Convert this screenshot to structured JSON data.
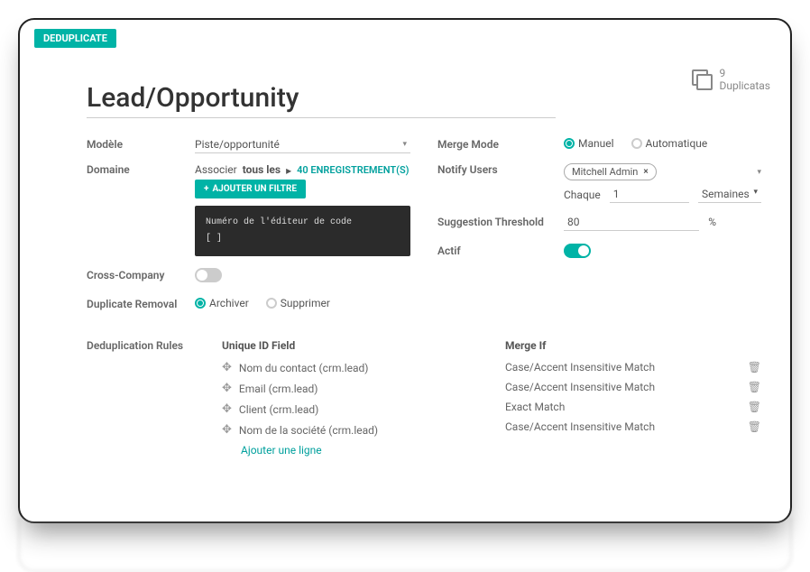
{
  "tag": "DEDUPLICATE",
  "duplicates": {
    "count": "9",
    "label": "Duplicatas"
  },
  "title": "Lead/Opportunity",
  "labels": {
    "model": "Modèle",
    "domain": "Domaine",
    "cross_company": "Cross-Company",
    "duplicate_removal": "Duplicate Removal",
    "merge_mode": "Merge Mode",
    "notify_users": "Notify Users",
    "suggestion_threshold": "Suggestion Threshold",
    "actif": "Actif",
    "dedup_rules": "Deduplication Rules",
    "unique_id": "Unique ID Field",
    "merge_if": "Merge If",
    "each": "Chaque"
  },
  "model": "Piste/opportunité",
  "domain": {
    "prefix": "Associer",
    "bold": "tous les",
    "records": "40 ENREGISTREMENT(S)",
    "filter_btn": "AJOUTER UN FILTRE",
    "code_comment": "Numéro de l'éditeur de code",
    "code": "[ ]"
  },
  "removal": {
    "archive": "Archiver",
    "delete": "Supprimer",
    "selected": "archive"
  },
  "merge_mode": {
    "manual": "Manuel",
    "auto": "Automatique",
    "selected": "manual"
  },
  "notify": {
    "user": "Mitchell Admin",
    "each_value": "1",
    "period": "Semaines"
  },
  "threshold": {
    "value": "80",
    "unit": "%"
  },
  "rules": [
    {
      "field": "Nom du contact (crm.lead)",
      "merge": "Case/Accent Insensitive Match"
    },
    {
      "field": "Email (crm.lead)",
      "merge": "Case/Accent Insensitive Match"
    },
    {
      "field": "Client (crm.lead)",
      "merge": "Exact Match"
    },
    {
      "field": "Nom de la société (crm.lead)",
      "merge": "Case/Accent Insensitive Match"
    }
  ],
  "add_line": "Ajouter une ligne"
}
